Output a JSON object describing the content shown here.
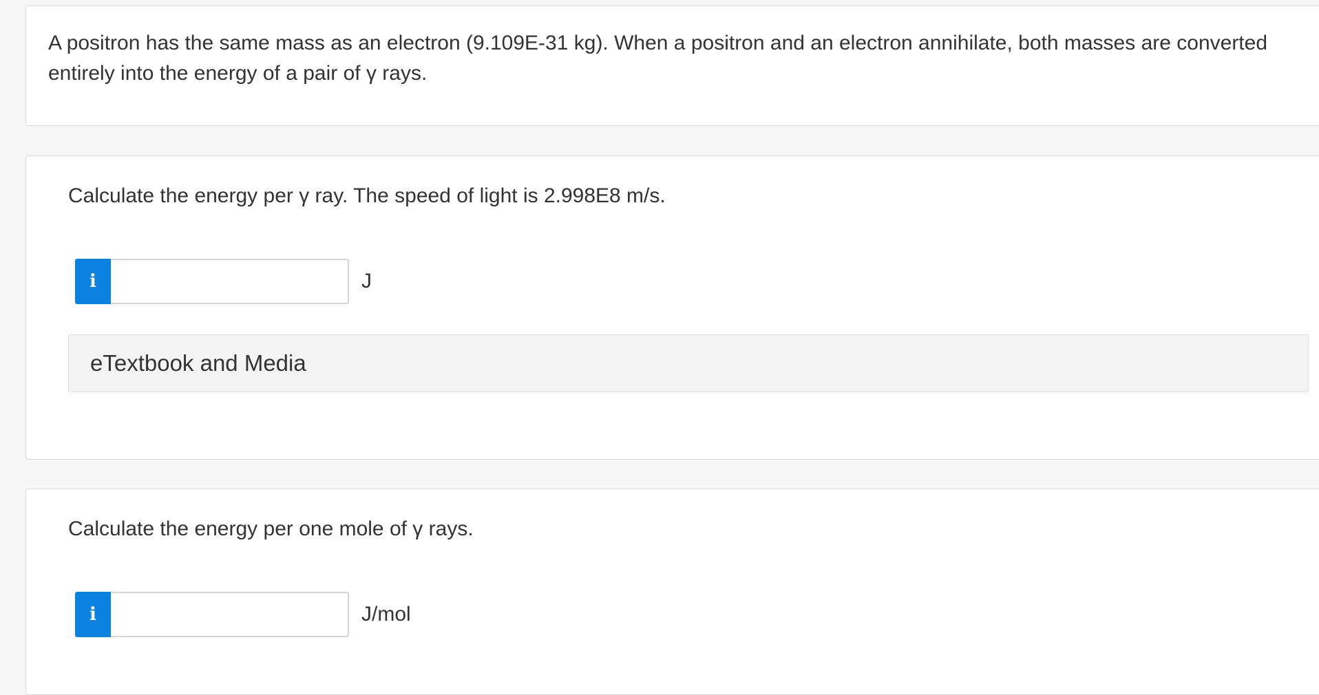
{
  "intro": {
    "text": "A positron has the same mass as an electron (9.109E-31 kg). When a positron and an electron annihilate, both masses are converted entirely into the energy of a pair of γ rays."
  },
  "questions": [
    {
      "prompt": "Calculate the energy per γ ray. The speed of light is 2.998E8 m/s.",
      "info_icon": "i",
      "input_value": "",
      "unit": "J",
      "resources_label": "eTextbook and Media"
    },
    {
      "prompt": "Calculate the energy per one mole of γ rays.",
      "info_icon": "i",
      "input_value": "",
      "unit": "J/mol"
    }
  ],
  "colors": {
    "info_button": "#0b82e0",
    "card_border": "#dcdcdc",
    "page_background": "#f7f7f7"
  }
}
